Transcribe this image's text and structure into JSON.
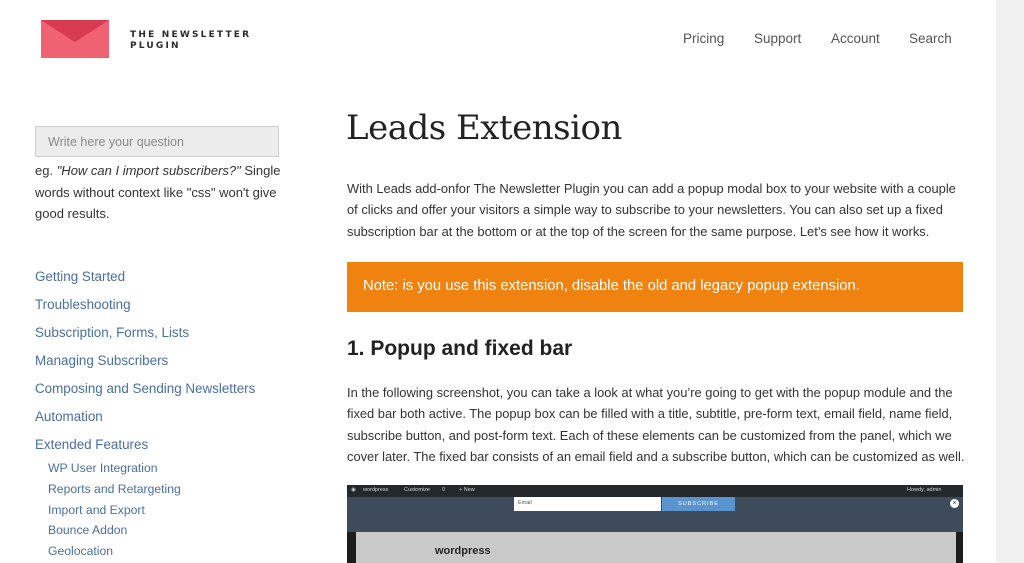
{
  "brand": {
    "line1": "THE NEWSLETTER",
    "line2": "PLUGIN",
    "accent": "#e8495f"
  },
  "nav": [
    "Pricing",
    "Support",
    "Account",
    "Search"
  ],
  "sidebar": {
    "search_placeholder": "Write here your question",
    "hint_prefix": "eg. ",
    "hint_example": "\"How can I import subscribers?\"",
    "hint_suffix": " Single words without context like \"css\" won't give good results.",
    "sections": [
      "Getting Started",
      "Troubleshooting",
      "Subscription, Forms, Lists",
      "Managing Subscribers",
      "Composing and Sending Newsletters",
      "Automation",
      "Extended Features"
    ],
    "subsections": [
      "WP User Integration",
      "Reports and Retargeting",
      "Import and Export",
      "Bounce Addon",
      "Geolocation"
    ]
  },
  "main": {
    "title": "Leads Extension",
    "intro": "With Leads add-onfor The Newsletter Plugin you can add a popup modal box to your website with a couple of clicks and offer your visitors a simple way to subscribe to your newsletters. You can also set up a fixed subscription bar at the bottom or at the top of the screen for the same purpose. Let’s see how it works.",
    "note": "Note: is you use this extension, disable the old and legacy popup extension.",
    "note_color": "#f0820f",
    "section_heading": "1. Popup and fixed bar",
    "section_text": "In the following screenshot, you can take a look at what you’re going to get with the popup module and the fixed bar both active. The popup box can be filled with a title, subtitle, pre-form text, email field, name field, subscribe button, and post-form text. Each of these elements can be customized from the panel, which we cover later. The fixed bar consists of an email field and a subscribe button, which can be customized as well."
  },
  "screenshot": {
    "adminbar_items": [
      "wordpress",
      "Customize",
      "0",
      "+ New"
    ],
    "adminbar_user": "Howdy, admin",
    "email_placeholder": "Email",
    "subscribe_label": "SUBSCRIBE",
    "close_icon": "×",
    "modal_title": "wordpress"
  }
}
